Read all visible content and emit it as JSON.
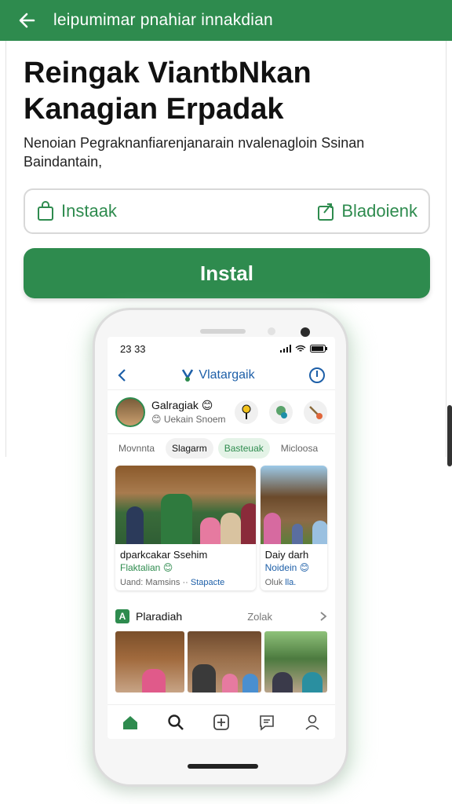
{
  "appbar": {
    "title": "leipumimar pnahiar innakdian",
    "back_icon": "arrow-left-icon"
  },
  "headline": "Reingak ViantbNkan Kanagian Erpadak",
  "subtext": "Nenoian Pegraknanfiarenjanarain nvalenagloin Ssinan Baindantain,",
  "options": {
    "left_label": "Instaak",
    "right_label": "Bladoienk"
  },
  "install_button": {
    "label": "Instal"
  },
  "phone": {
    "status": {
      "time": "23 33"
    },
    "header": {
      "title": "Vlatargaik"
    },
    "profile": {
      "name": "Galragiak 😊",
      "subtitle": "😊 Uekain Snoem"
    },
    "chips": [
      "Movnnta",
      "Slagarm",
      "Basteuak",
      "Micloosa"
    ],
    "cards": [
      {
        "title": "dparkcakar Ssehim",
        "subtitle": "Flaktalian 😊",
        "meta": "Uand: Mamsins ··",
        "meta_link": "Stapacte"
      },
      {
        "title": "Daiy darh",
        "subtitle": "Noidein 😊",
        "meta": "Oluk",
        "meta_link": "lla."
      }
    ],
    "section": {
      "badge": "A",
      "title": "Plaradiah",
      "link": "Zolak"
    }
  },
  "colors": {
    "brand_green": "#2e8b4e",
    "link_blue": "#1d5fa8"
  }
}
